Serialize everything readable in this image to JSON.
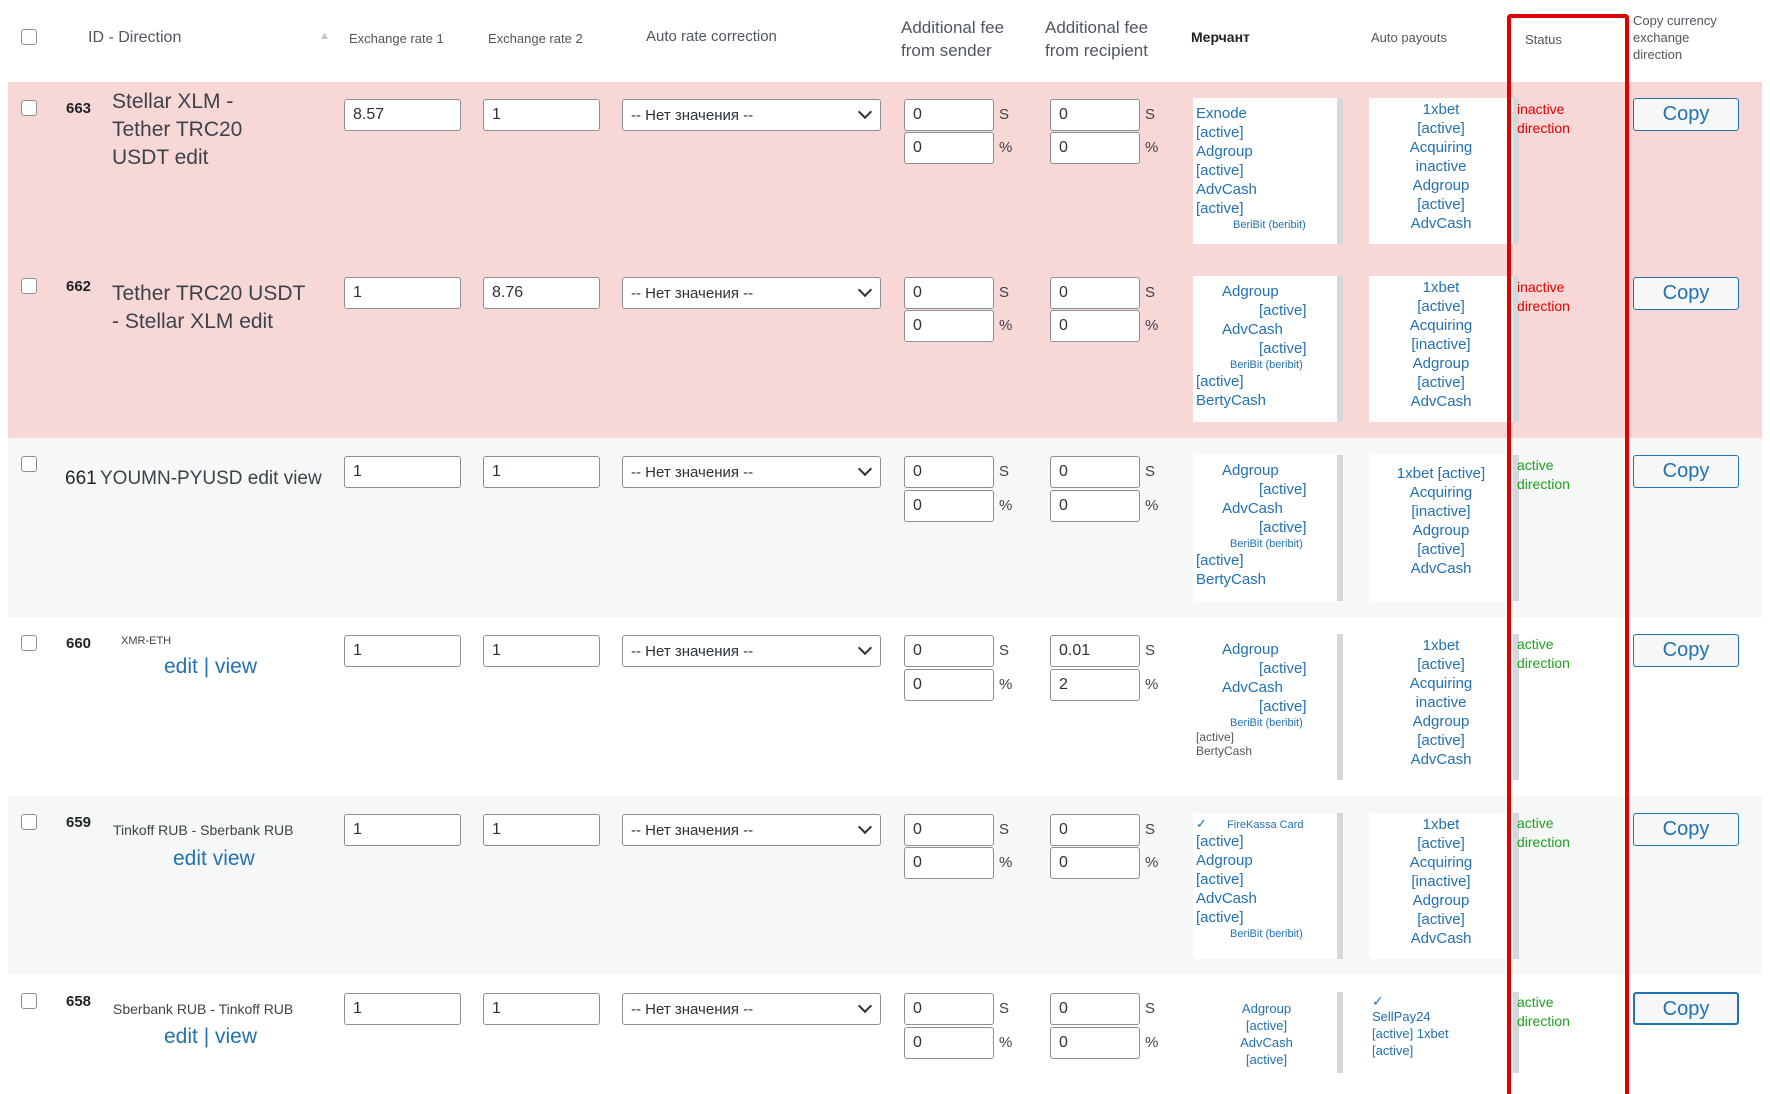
{
  "header": {
    "id_direction": "ID - Direction",
    "exchange_rate_1": "Exchange rate 1",
    "exchange_rate_2": "Exchange rate 2",
    "auto_rate_correction": "Auto rate correction",
    "fee_sender_1": "Additional fee",
    "fee_sender_2": "from sender",
    "fee_recipient_1": "Additional fee",
    "fee_recipient_2": "from recipient",
    "merchant": "Мерчант",
    "auto_payouts": "Auto payouts",
    "status": "Status",
    "copy_1": "Copy currency",
    "copy_2": "exchange",
    "copy_3": "direction"
  },
  "select_placeholder": "-- Нет значения --",
  "symbol_dollar": "S",
  "symbol_percent": "%",
  "copy_label": "Copy",
  "rows": [
    {
      "id": "663",
      "direction_l1": "Stellar XLM -",
      "direction_l2": "Tether TRC20",
      "direction_l3": "USDT edit",
      "rate1": "8.57",
      "rate2": "1",
      "fee_s_abs": "0",
      "fee_s_pct": "0",
      "fee_r_abs": "0",
      "fee_r_pct": "0",
      "merchant": [
        "Exnode",
        "[active]",
        "Adgroup",
        "[active]",
        "AdvCash",
        "[active]"
      ],
      "merchant_small": "BeriBit (beribit)",
      "payouts": [
        "1xbet",
        "[active]",
        "Acquiring",
        "inactive",
        "Adgroup",
        "[active]",
        "AdvCash"
      ],
      "status_1": "inactive",
      "status_2": "direction"
    },
    {
      "id": "662",
      "direction_l1": "Tether TRC20 USDT",
      "direction_l2": "- Stellar XLM edit",
      "rate1": "1",
      "rate2": "8.76",
      "fee_s_abs": "0",
      "fee_s_pct": "0",
      "fee_r_abs": "0",
      "fee_r_pct": "0",
      "merchant": [
        "Adgroup",
        "[active]",
        "AdvCash",
        "[active]"
      ],
      "merchant_small": "BeriBit (beribit)",
      "merchant_tail": [
        "[active]",
        "BertyCash"
      ],
      "payouts": [
        "1xbet",
        "[active]",
        "Acquiring",
        "[inactive]",
        "Adgroup",
        "[active]",
        "AdvCash"
      ],
      "status_1": "inactive",
      "status_2": "direction"
    },
    {
      "id": "661",
      "direction_l1": "YOUMN-PYUSD edit view",
      "rate1": "1",
      "rate2": "1",
      "fee_s_abs": "0",
      "fee_s_pct": "0",
      "fee_r_abs": "0",
      "fee_r_pct": "0",
      "merchant": [
        "Adgroup",
        "[active]",
        "AdvCash",
        "[active]"
      ],
      "merchant_small": "BeriBit (beribit)",
      "merchant_tail": [
        "[active]",
        "BertyCash"
      ],
      "payouts": [
        "1xbet [active]",
        "Acquiring",
        "[inactive]",
        "Adgroup",
        "[active]",
        "AdvCash"
      ],
      "status_1": "active",
      "status_2": "direction"
    },
    {
      "id": "660",
      "direction_small": "XMR-ETH",
      "edit": "edit",
      "sep": "|",
      "view": "view",
      "rate1": "1",
      "rate2": "1",
      "fee_s_abs": "0",
      "fee_s_pct": "0",
      "fee_r_abs": "0.01",
      "fee_r_pct": "2",
      "merchant": [
        "Adgroup",
        "[active]",
        "AdvCash",
        "[active]"
      ],
      "merchant_small": "BeriBit (beribit)",
      "merchant_tail": [
        "[active]",
        "BertyCash"
      ],
      "payouts": [
        "1xbet",
        "[active]",
        "Acquiring",
        "inactive",
        "Adgroup",
        "[active]",
        "AdvCash"
      ],
      "status_1": "active",
      "status_2": "direction"
    },
    {
      "id": "659",
      "direction_small": "Tinkoff RUB - Sberbank RUB",
      "edit_view": "edit view",
      "rate1": "1",
      "rate2": "1",
      "fee_s_abs": "0",
      "fee_s_pct": "0",
      "fee_r_abs": "0",
      "fee_r_pct": "0",
      "merchant_small_top": "FireKassa Card",
      "merchant": [
        "[active]",
        "Adgroup",
        "[active]",
        "AdvCash",
        "[active]"
      ],
      "merchant_small": "BeriBit (beribit)",
      "payouts": [
        "1xbet",
        "[active]",
        "Acquiring",
        "[inactive]",
        "Adgroup",
        "[active]",
        "AdvCash"
      ],
      "status_1": "active",
      "status_2": "direction"
    },
    {
      "id": "658",
      "direction_small": "Sberbank RUB - Tinkoff RUB",
      "edit": "edit",
      "sep": "|",
      "view": "view",
      "rate1": "1",
      "rate2": "1",
      "fee_s_abs": "0",
      "fee_s_pct": "0",
      "fee_r_abs": "0",
      "fee_r_pct": "0",
      "merchant": [
        "Adgroup",
        "[active]",
        "AdvCash",
        "[active]"
      ],
      "payouts": [
        "SellPay24",
        "[active] 1xbet",
        "[active]"
      ],
      "status_1": "active",
      "status_2": "direction"
    }
  ]
}
